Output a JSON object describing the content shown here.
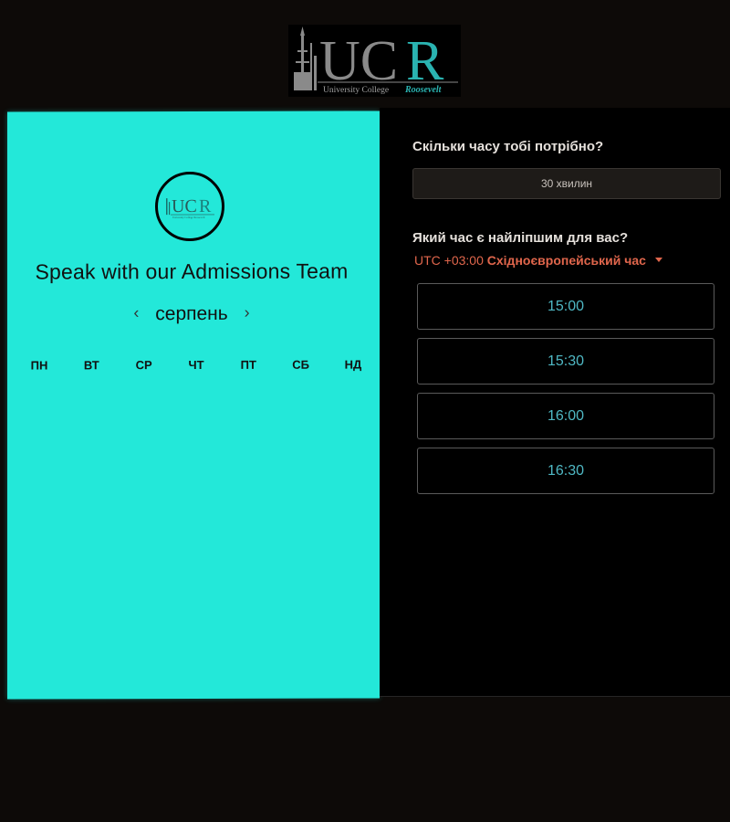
{
  "header": {
    "logo_text": "UCR",
    "logo_subtitle_plain": "University College",
    "logo_subtitle_accent": "Roosevelt"
  },
  "calendar_panel": {
    "logo_text": "UCR",
    "title": "Speak with our Admissions Team",
    "month": "серпень",
    "prev_icon": "chevron-left-icon",
    "next_icon": "chevron-right-icon",
    "weekdays": [
      "ПН",
      "ВТ",
      "СР",
      "ЧТ",
      "ПТ",
      "СБ",
      "НД"
    ]
  },
  "booking_panel": {
    "duration_question": "Скільки часу тобі потрібно?",
    "duration_value": "30 хвилин",
    "time_question": "Який час є найліпшим для вас?",
    "timezone_offset": "UTC +03:00",
    "timezone_name": "Східноєвропейський час",
    "time_slots": [
      "15:00",
      "15:30",
      "16:00",
      "16:30"
    ]
  },
  "colors": {
    "page_background": "#0d0a08",
    "calendar_background": "#23e8d9",
    "booking_background": "#000000",
    "timezone_accent": "#e0664c",
    "slot_text": "#4fb8c4",
    "logo_teal": "#2ab3b1",
    "logo_gray": "#8a8a8a"
  }
}
